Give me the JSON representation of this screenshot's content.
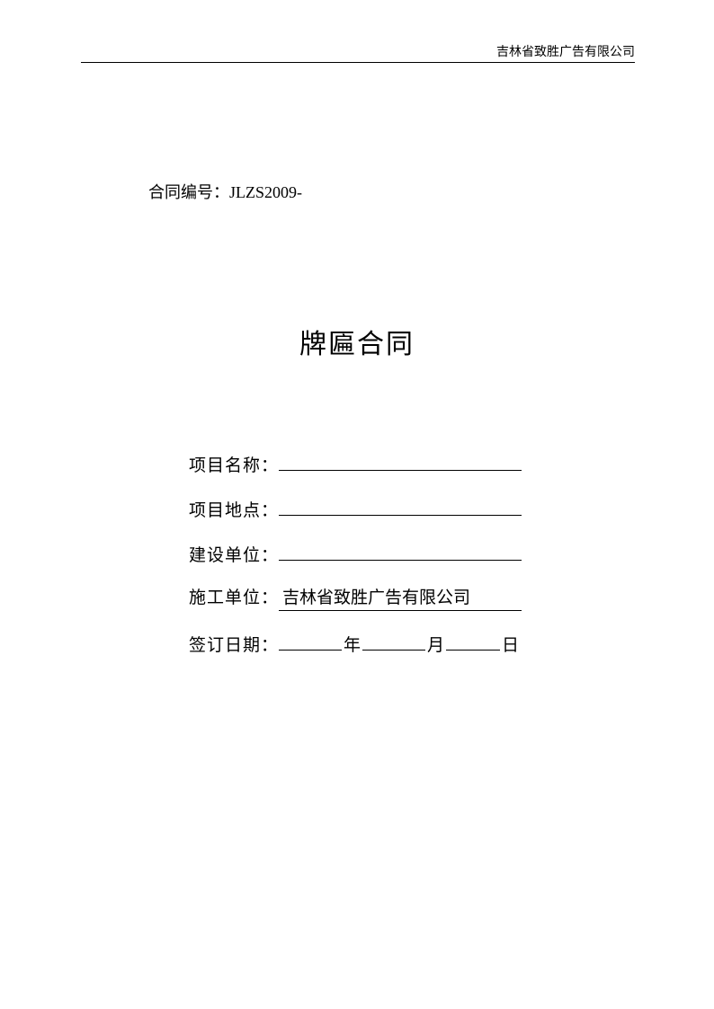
{
  "header": {
    "company": "吉林省致胜广告有限公司"
  },
  "contract": {
    "number_label": "合同编号：",
    "number_value": "JLZS2009-",
    "title": "牌匾合同"
  },
  "fields": {
    "project_name_label": "项目名称：",
    "project_name_value": "",
    "project_location_label": "项目地点：",
    "project_location_value": "",
    "construction_unit_label": "建设单位：",
    "construction_unit_value": "",
    "contractor_label": "施工单位：",
    "contractor_value": "吉林省致胜广告有限公司",
    "sign_date_label": "签订日期：",
    "year_unit": "年",
    "month_unit": "月",
    "day_unit": "日"
  }
}
